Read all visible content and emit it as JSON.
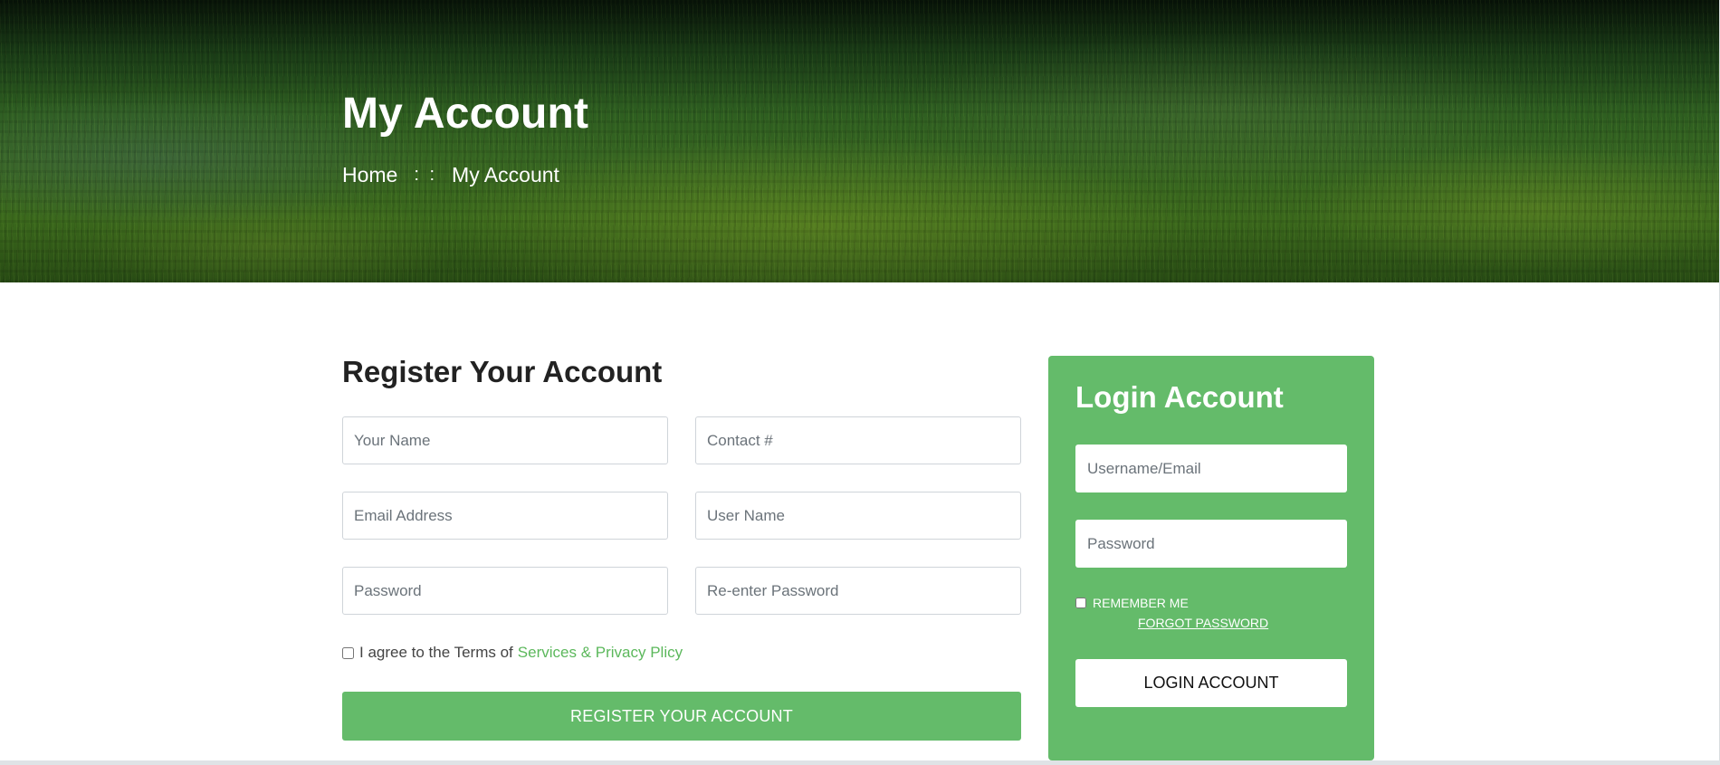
{
  "hero": {
    "title": "My Account",
    "breadcrumb": {
      "home": "Home",
      "separator": ": :",
      "current": "My Account"
    }
  },
  "register": {
    "title": "Register Your Account",
    "fields": {
      "name_placeholder": "Your Name",
      "contact_placeholder": "Contact #",
      "email_placeholder": "Email Address",
      "username_placeholder": "User Name",
      "password_placeholder": "Password",
      "reenter_password_placeholder": "Re-enter Password"
    },
    "terms": {
      "text": "I agree to the Terms of",
      "link": "Services & Privacy Plicy",
      "checked": false
    },
    "submit_label": "REGISTER YOUR ACCOUNT"
  },
  "login": {
    "title": "Login Account",
    "username_placeholder": "Username/Email",
    "password_placeholder": "Password",
    "remember_label": "REMEMBER ME",
    "remember_checked": false,
    "forgot_label": "FORGOT PASSWORD",
    "submit_label": "LOGIN ACCOUNT"
  },
  "colors": {
    "accent_green": "#64bb6a",
    "link_green": "#5cb85c",
    "heading_text": "#222222"
  }
}
